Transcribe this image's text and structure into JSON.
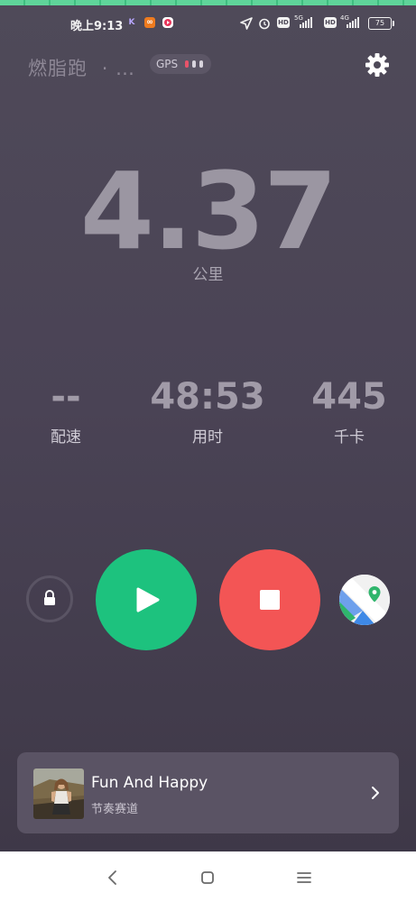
{
  "status_bar": {
    "time": "晚上9:13",
    "network_1": "5G",
    "network_2": "4G",
    "hd_1": "HD",
    "hd_2": "HD",
    "battery": "75",
    "icons": [
      "k-app-icon",
      "orange-app-icon",
      "red-app-icon",
      "location-arrow-icon",
      "alarm-icon",
      "signal-icon",
      "signal-icon",
      "battery-icon"
    ]
  },
  "header": {
    "title": "燃脂跑",
    "separator": "·  …",
    "gps_label": "GPS",
    "gps_signal_level": 1,
    "settings_icon": "gear-icon"
  },
  "main": {
    "distance": "4.37",
    "distance_unit": "公里",
    "stats": [
      {
        "value": "--",
        "label": "配速"
      },
      {
        "value": "48:53",
        "label": "用时"
      },
      {
        "value": "445",
        "label": "千卡"
      }
    ]
  },
  "controls": {
    "lock_icon": "lock-icon",
    "play_icon": "play-icon",
    "stop_icon": "stop-icon",
    "map_icon": "map-pin-icon"
  },
  "music": {
    "title": "Fun And Happy",
    "subtitle": "节奏赛道",
    "chevron_icon": "chevron-right-icon"
  },
  "nav_bar": {
    "back_icon": "back-icon",
    "home_icon": "home-icon",
    "menu_icon": "menu-icon"
  },
  "colors": {
    "play": "#1dc27e",
    "stop": "#f35555",
    "gps_active": "#e8536a",
    "gps_inactive": "#d8d4dd"
  }
}
